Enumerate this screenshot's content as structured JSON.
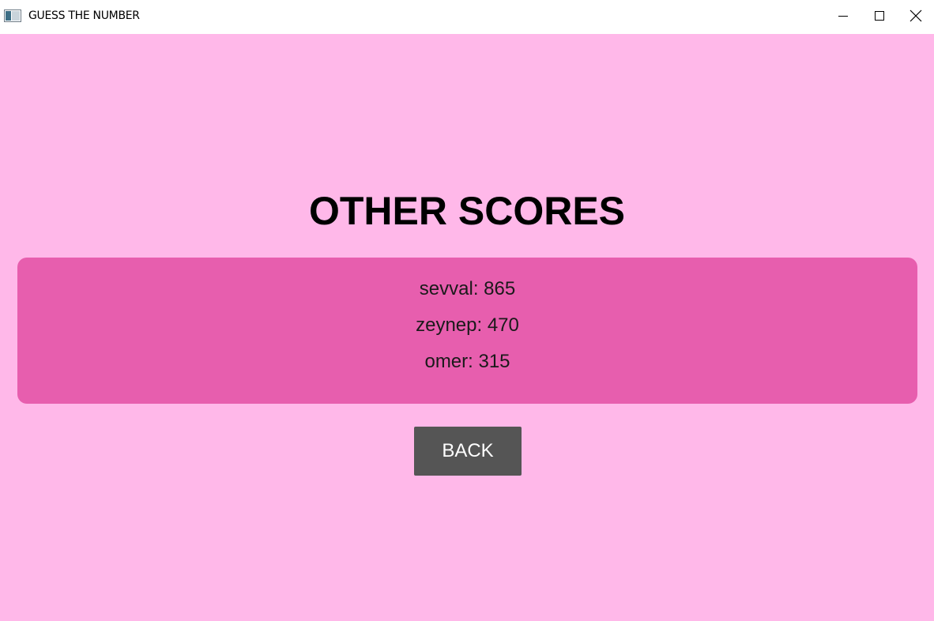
{
  "window": {
    "title": "GUESS THE NUMBER",
    "icon": "app-window-icon",
    "controls": [
      "minimize-icon",
      "maximize-icon",
      "close-icon"
    ]
  },
  "main": {
    "heading": "OTHER SCORES",
    "scores": [
      {
        "text": "sevval: 865"
      },
      {
        "text": "zeynep: 470"
      },
      {
        "text": "omer: 315"
      }
    ],
    "back_label": "BACK"
  },
  "colors": {
    "background": "#ffb8e9",
    "panel": "#e75eae",
    "button": "#555555",
    "button_text": "#ffffff"
  }
}
